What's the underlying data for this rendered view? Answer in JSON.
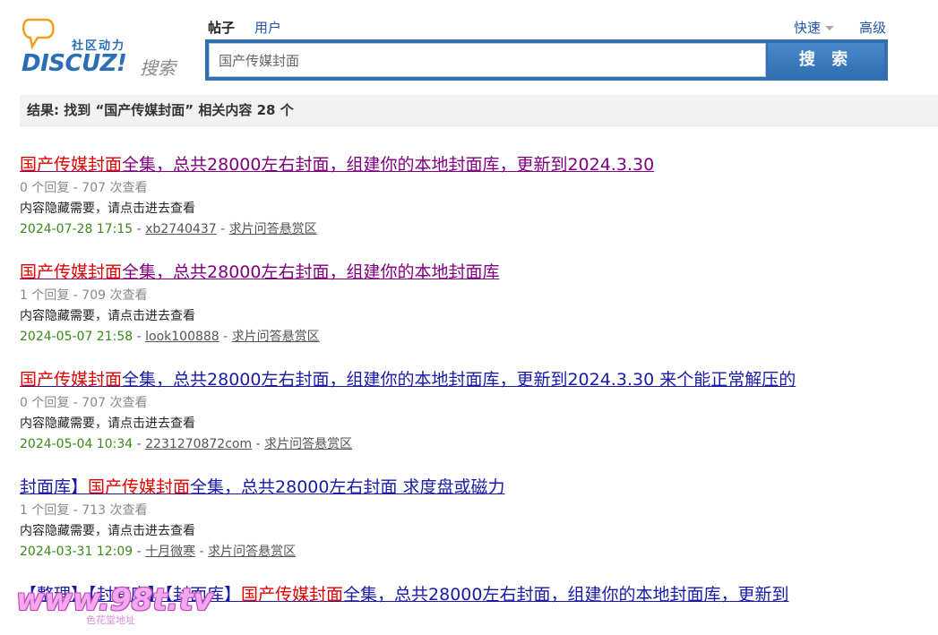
{
  "logo": {
    "sub": "社区动力",
    "main": "DISCUZ!",
    "search_word": "搜索"
  },
  "tabs": [
    {
      "label": "帖子",
      "active": true
    },
    {
      "label": "用户",
      "active": false
    }
  ],
  "right_links": {
    "quick": "快速",
    "advanced": "高级"
  },
  "search": {
    "value": "国产传媒封面",
    "button": "搜 索"
  },
  "result_summary": "结果: 找到 “国产传媒封面” 相关内容 28 个",
  "results": [
    {
      "prefix": "",
      "highlight": "国产传媒封面",
      "suffix": "全集，总共28000左右封面，组建你的本地封面库，更新到2024.3.30",
      "visited": true,
      "stats": "0 个回复 - 707 次查看",
      "desc": "内容隐藏需要，请点击进去查看",
      "date": "2024-07-28 17:15",
      "author": "xb2740437",
      "forum": "求片问答悬赏区"
    },
    {
      "prefix": "",
      "highlight": "国产传媒封面",
      "suffix": "全集，总共28000左右封面，组建你的本地封面库",
      "visited": true,
      "stats": "1 个回复 - 709 次查看",
      "desc": "内容隐藏需要，请点击进去查看",
      "date": "2024-05-07 21:58",
      "author": "look100888",
      "forum": "求片问答悬赏区"
    },
    {
      "prefix": "",
      "highlight": "国产传媒封面",
      "suffix": "全集，总共28000左右封面，组建你的本地封面库，更新到2024.3.30 来个能正常解压的",
      "visited": false,
      "stats": "0 个回复 - 707 次查看",
      "desc": "内容隐藏需要，请点击进去查看",
      "date": "2024-05-04 10:34",
      "author": "2231270872com",
      "forum": "求片问答悬赏区"
    },
    {
      "prefix": "封面库】",
      "highlight": "国产传媒封面",
      "suffix": "全集，总共28000左右封面 求度盘或磁力",
      "visited": false,
      "stats": "1 个回复 - 713 次查看",
      "desc": "内容隐藏需要，请点击进去查看",
      "date": "2024-03-31 12:09",
      "author": "十月微寒",
      "forum": "求片问答悬赏区"
    },
    {
      "prefix": "【整理】【封面库】【封面库】",
      "highlight": "国产传媒封面",
      "suffix": "全集，总共28000左右封面，组建你的本地封面库，更新到",
      "visited": false,
      "stats": "",
      "desc": "",
      "date": "",
      "author": "",
      "forum": ""
    }
  ],
  "watermark": {
    "text": "www.98t.tv",
    "sub": "色花堂地址"
  },
  "colors": {
    "accent": "#2f6fb2",
    "highlight": "#e00000",
    "visited": "#800080",
    "link": "#1a1aa6",
    "date": "#3a8a1a"
  }
}
